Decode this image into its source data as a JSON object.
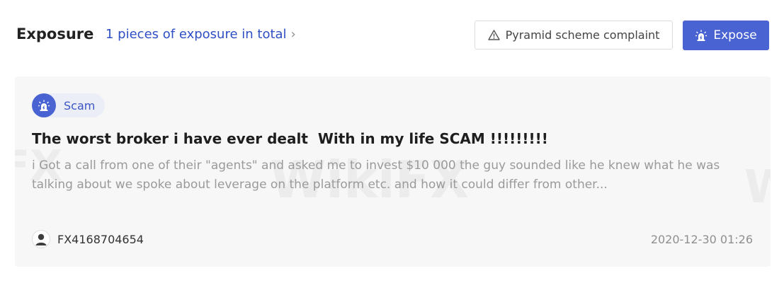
{
  "header": {
    "title": "Exposure",
    "total_link": "1 pieces of exposure in total",
    "chevron": "›",
    "complaint_button": "Pyramid scheme complaint",
    "complaint_icon": "warning-triangle-icon",
    "expose_button": "Expose",
    "expose_icon": "alarm-light-icon"
  },
  "post": {
    "tag": "Scam",
    "tag_icon": "alarm-light-icon",
    "title": "The worst broker i have ever dealt  With in my life SCAM !!!!!!!!!",
    "body": "i Got a call from one of their \"agents\" and asked me to invest $10 000 the guy sounded like he knew what he was talking about we spoke about leverage on the platform etc. and how it could differ from other...",
    "author": "FX4168704654",
    "author_icon": "user-avatar-icon",
    "timestamp": "2020-12-30 01:26"
  },
  "watermark": {
    "text_left": "FX",
    "text_center": "WikiFX",
    "text_right": "W"
  },
  "colors": {
    "accent": "#4a63d3",
    "link": "#2f4fc4",
    "card_bg": "#f7f7f7"
  }
}
